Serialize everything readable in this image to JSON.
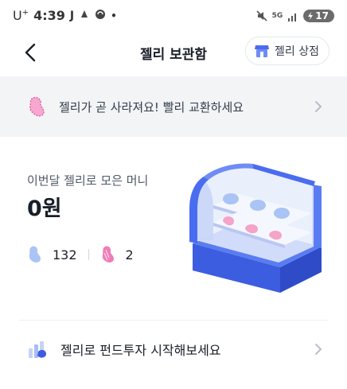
{
  "status_bar": {
    "carrier": "U",
    "carrier_sup": "+",
    "time": "4:39",
    "icon_j": "J",
    "dot": "•",
    "network": "5G",
    "battery": "17"
  },
  "header": {
    "title": "젤리 보관함",
    "store_label": "젤리 상점"
  },
  "notice": {
    "text": "젤리가 곧 사라져요! 빨리 교환하세요"
  },
  "summary": {
    "label": "이번달 젤리로 모은 머니",
    "value": "0원",
    "blue_jelly_count": "132",
    "pink_jelly_count": "2"
  },
  "fund": {
    "text": "젤리로 펀드투자 시작해보세요"
  },
  "colors": {
    "accent_blue": "#4a6cf0",
    "jelly_blue": "#a9c4f5",
    "jelly_pink": "#f07cb8",
    "banner_bg": "#f2f4f6"
  },
  "icons": [
    "back-arrow-icon",
    "store-icon",
    "pink-jelly-icon",
    "chevron-right-icon",
    "blue-jelly-icon",
    "fund-chart-icon",
    "mute-icon",
    "signal-icon",
    "battery-icon"
  ]
}
